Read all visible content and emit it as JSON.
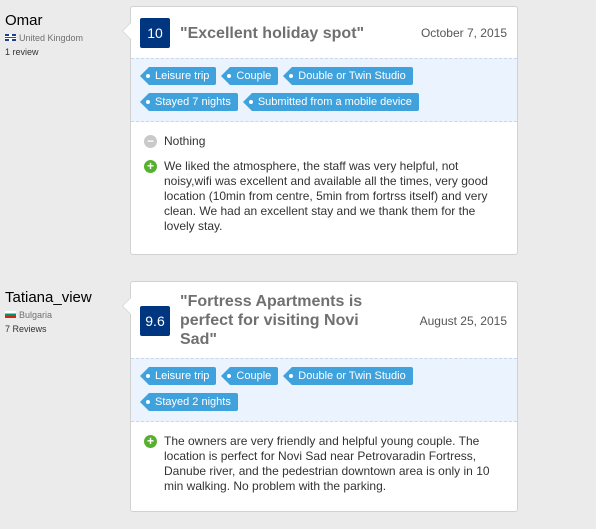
{
  "reviews": [
    {
      "reviewer": {
        "name": "Omar",
        "country": "United Kingdom",
        "flag": "uk-flag-icon",
        "review_count": "1 review"
      },
      "score": "10",
      "title": "\"Excellent holiday spot\"",
      "date": "October 7, 2015",
      "tags": [
        "Leisure trip",
        "Couple",
        "Double or Twin Studio",
        "Stayed 7 nights",
        "Submitted from a mobile device"
      ],
      "negative": "Nothing",
      "positive": "We liked the atmosphere, the staff was very helpful, not noisy,wifi was excellent and available all the times, very good location (10min from centre, 5min from fortrss itself) and very clean. We had an excellent stay and we thank them for the lovely stay."
    },
    {
      "reviewer": {
        "name": "Tatiana_view",
        "country": "Bulgaria",
        "flag": "bulgaria-flag-icon",
        "review_count": "7 Reviews"
      },
      "score": "9.6",
      "title": "\"Fortress Apartments is perfect for visiting Novi Sad\"",
      "date": "August 25, 2015",
      "tags": [
        "Leisure trip",
        "Couple",
        "Double or Twin Studio",
        "Stayed 2 nights"
      ],
      "positive": "The owners are very friendly and helpful young couple. The location is perfect for Novi Sad near Petrovaradin Fortress, Danube river, and the pedestrian downtown area is only in 10 min walking. No problem with the parking."
    }
  ],
  "colors": {
    "score_bg": "#003580",
    "tag_bg": "#3fa2dd",
    "tags_strip_bg": "#ebf3ff",
    "positive_icon": "#58b02f",
    "negative_icon": "#c9c9c9",
    "page_bg": "#ebebeb"
  },
  "icons": {
    "negative": "minus-circle-icon",
    "positive": "plus-circle-icon"
  }
}
